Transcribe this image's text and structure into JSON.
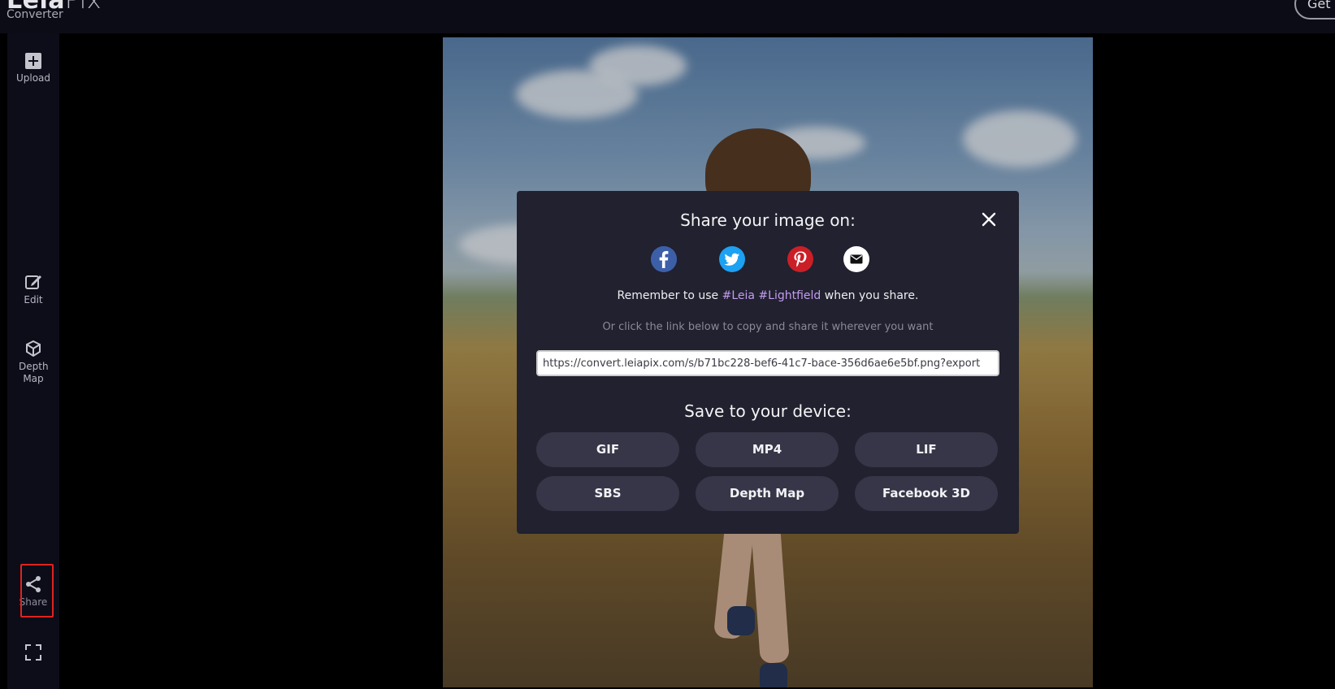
{
  "app": {
    "logo_bold": "Leia",
    "logo_light": "Pix",
    "subtitle": "Converter",
    "get_button_label": "Get"
  },
  "sidebar": {
    "items": [
      {
        "label": "Upload",
        "icon": "plus-square-icon"
      },
      {
        "label": "Edit",
        "icon": "edit-icon"
      },
      {
        "label": "Depth Map",
        "icon": "depth-map-icon"
      },
      {
        "label": "Share",
        "icon": "share-icon"
      },
      {
        "label": "",
        "icon": "fullscreen-icon"
      }
    ]
  },
  "modal": {
    "title": "Share your image on:",
    "social": [
      "facebook-icon",
      "twitter-icon",
      "pinterest-icon",
      "email-icon"
    ],
    "remember_prefix": "Remember to use ",
    "hashtags": "#Leia #Lightfield",
    "remember_suffix": " when you share.",
    "or_text": "Or click the link below to copy and share it wherever you want",
    "share_link": "https://convert.leiapix.com/s/b71bc228-bef6-41c7-bace-356d6ae6e5bf.png?export",
    "save_title": "Save to your device:",
    "save_buttons": [
      "GIF",
      "MP4",
      "LIF",
      "SBS",
      "Depth Map",
      "Facebook 3D"
    ]
  },
  "colors": {
    "modal_bg": "#21212f",
    "button_bg": "#363648",
    "hashtag": "#c59cf0",
    "highlight": "#e0231e"
  }
}
